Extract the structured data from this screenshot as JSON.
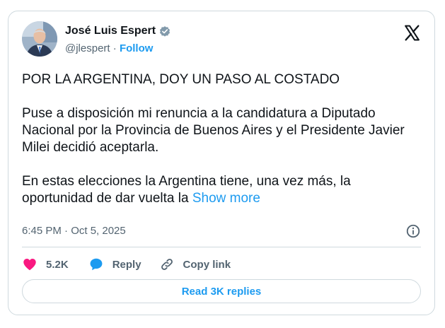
{
  "author": {
    "display_name": "José Luis Espert",
    "handle": "@jlespert",
    "separator": " · ",
    "follow_label": "Follow",
    "verified": true
  },
  "tweet": {
    "paragraphs": [
      "POR LA ARGENTINA, DOY UN PASO AL COSTADO",
      "Puse a disposición mi renuncia a la candidatura a Diputado Nacional por la Provincia de Buenos Aires y el Presidente Javier Milei decidió aceptarla.",
      "En estas elecciones la Argentina tiene, una vez más, la oportunidad de dar vuelta la"
    ],
    "show_more_label": "Show more",
    "timestamp": "6:45 PM · Oct 5, 2025"
  },
  "actions": {
    "like_count": "5.2K",
    "reply_label": "Reply",
    "copy_link_label": "Copy link"
  },
  "replies_button_label": "Read 3K replies",
  "colors": {
    "accent": "#1d9bf0",
    "like": "#f91880",
    "verified": "#829aab",
    "text_primary": "#0f1419",
    "text_secondary": "#536471",
    "border": "#cfd9de"
  },
  "icons": {
    "avatar": "avatar",
    "verified": "verified-badge-icon",
    "logo": "x-logo-icon",
    "info": "info-icon",
    "like": "heart-icon",
    "reply": "speech-bubble-icon",
    "copy_link": "link-icon"
  }
}
